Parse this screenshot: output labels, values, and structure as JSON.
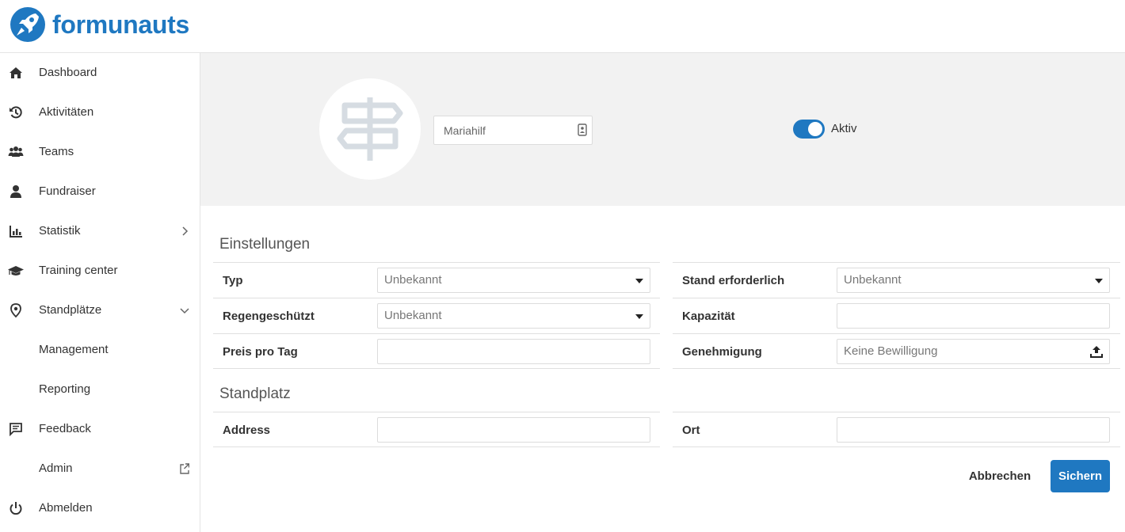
{
  "app": {
    "name": "formunauts",
    "brand_color": "#1f78c1"
  },
  "sidebar": {
    "items": [
      {
        "label": "Dashboard",
        "icon": "home-icon"
      },
      {
        "label": "Aktivitäten",
        "icon": "history-icon"
      },
      {
        "label": "Teams",
        "icon": "users-icon"
      },
      {
        "label": "Fundraiser",
        "icon": "user-icon"
      },
      {
        "label": "Statistik",
        "icon": "chart-icon",
        "chevron": "chevron-right-icon"
      },
      {
        "label": "Training center",
        "icon": "graduation-cap-icon"
      },
      {
        "label": "Standplätze",
        "icon": "map-pin-icon",
        "chevron": "chevron-down-icon"
      },
      {
        "label": "Management"
      },
      {
        "label": "Reporting"
      },
      {
        "label": "Feedback",
        "icon": "comment-icon"
      },
      {
        "label": "Admin",
        "icon": "external-link-icon"
      },
      {
        "label": "Abmelden",
        "icon": "power-icon"
      }
    ]
  },
  "header": {
    "name_value": "Mariahilf",
    "status_label": "Aktiv",
    "status_active": true,
    "avatar_icon": "signpost-icon"
  },
  "settings": {
    "title": "Einstellungen",
    "left": [
      {
        "label": "Typ",
        "value": "Unbekannt",
        "kind": "select"
      },
      {
        "label": "Regengeschützt",
        "value": "Unbekannt",
        "kind": "select"
      },
      {
        "label": "Preis pro Tag",
        "value": "",
        "kind": "input"
      }
    ],
    "right": [
      {
        "label": "Stand erforderlich",
        "value": "Unbekannt",
        "kind": "select"
      },
      {
        "label": "Kapazität",
        "value": "",
        "kind": "input"
      },
      {
        "label": "Genehmigung",
        "value": "Keine Bewilligung",
        "kind": "upload"
      }
    ]
  },
  "location": {
    "title": "Standplatz",
    "left": [
      {
        "label": "Address",
        "value": ""
      }
    ],
    "right": [
      {
        "label": "Ort",
        "value": ""
      }
    ]
  },
  "actions": {
    "cancel": "Abbrechen",
    "save": "Sichern"
  }
}
